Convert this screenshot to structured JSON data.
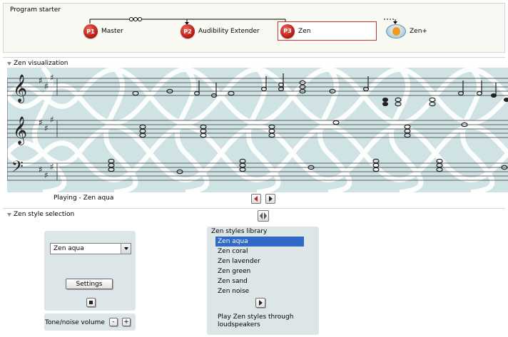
{
  "program_starter": {
    "title": "Program starter",
    "programs": [
      {
        "badge": "P1",
        "label": "Master"
      },
      {
        "badge": "P2",
        "label": "Audibility Extender"
      },
      {
        "badge": "P3",
        "label": "Zen"
      },
      {
        "badge": "",
        "label": "Zen+"
      }
    ]
  },
  "visualization": {
    "title": "Zen visualization",
    "status": "Playing - Zen aqua",
    "key_signature": "A major (3 sharps)",
    "colors": {
      "background": "#cfe2e4",
      "waves": "#ffffff"
    }
  },
  "style_selection": {
    "title": "Zen style selection",
    "selected_style": "Zen aqua",
    "settings_label": "Settings",
    "volume_label": "Tone/noise volume",
    "volume_down": "-",
    "volume_up": "+",
    "library": {
      "title": "Zen styles library",
      "items": [
        "Zen aqua",
        "Zen coral",
        "Zen lavender",
        "Zen green",
        "Zen sand",
        "Zen noise"
      ],
      "selected_index": 0
    },
    "play_through_label": "Play Zen styles through loudspeakers"
  },
  "icons": {
    "collapse": "triangle-down-icon",
    "prev": "previous-icon",
    "next": "next-icon",
    "stop": "stop-icon",
    "play": "play-icon",
    "toggle": "panel-toggle-icon"
  },
  "accent_colors": {
    "program_badge": "#c8231b",
    "selection": "#316ac5"
  }
}
